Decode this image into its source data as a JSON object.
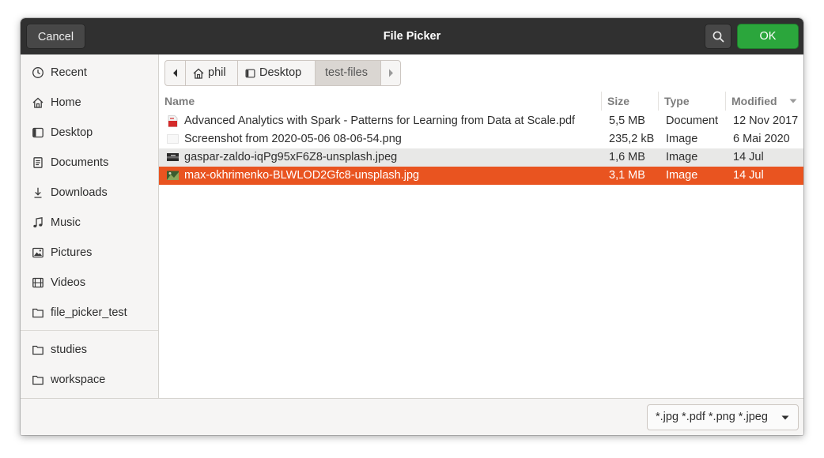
{
  "header": {
    "title": "File Picker",
    "cancel_label": "Cancel",
    "ok_label": "OK",
    "search_icon": "search-icon"
  },
  "sidebar": {
    "items": [
      {
        "label": "Recent",
        "icon": "clock-icon"
      },
      {
        "label": "Home",
        "icon": "home-icon"
      },
      {
        "label": "Desktop",
        "icon": "desktop-icon"
      },
      {
        "label": "Documents",
        "icon": "document-icon"
      },
      {
        "label": "Downloads",
        "icon": "download-icon"
      },
      {
        "label": "Music",
        "icon": "music-icon"
      },
      {
        "label": "Pictures",
        "icon": "picture-icon"
      },
      {
        "label": "Videos",
        "icon": "video-icon"
      },
      {
        "label": "file_picker_test",
        "icon": "folder-icon"
      },
      {
        "label": "studies",
        "icon": "folder-icon"
      },
      {
        "label": "workspace",
        "icon": "folder-icon"
      }
    ]
  },
  "pathbar": {
    "segments": [
      {
        "label": "phil",
        "icon": "home-icon"
      },
      {
        "label": "Desktop",
        "icon": "desktop-icon"
      },
      {
        "label": "test-files",
        "current": true
      }
    ]
  },
  "columns": {
    "name": "Name",
    "size": "Size",
    "type": "Type",
    "modified": "Modified"
  },
  "files": [
    {
      "name": "Advanced Analytics with Spark - Patterns for Learning from Data at Scale.pdf",
      "size": "5,5 MB",
      "type": "Document",
      "modified": "12 Nov 2017",
      "icon": "pdf-icon"
    },
    {
      "name": "Screenshot from 2020-05-06 08-06-54.png",
      "size": "235,2 kB",
      "type": "Image",
      "modified": "6 Mai 2020",
      "icon": "image-thumbnail-icon"
    },
    {
      "name": "gaspar-zaldo-iqPg95xF6Z8-unsplash.jpeg",
      "size": "1,6 MB",
      "type": "Image",
      "modified": "14 Jul",
      "icon": "image-thumbnail-icon"
    },
    {
      "name": "max-okhrimenko-BLWLOD2Gfc8-unsplash.jpg",
      "size": "3,1 MB",
      "type": "Image",
      "modified": "14 Jul",
      "icon": "image-thumbnail-icon",
      "selected": true
    }
  ],
  "footer": {
    "filter_label": "*.jpg *.pdf *.png *.jpeg"
  },
  "colors": {
    "selection": "#e95420",
    "ok_button": "#2ba63c",
    "headerbar": "#303030"
  }
}
